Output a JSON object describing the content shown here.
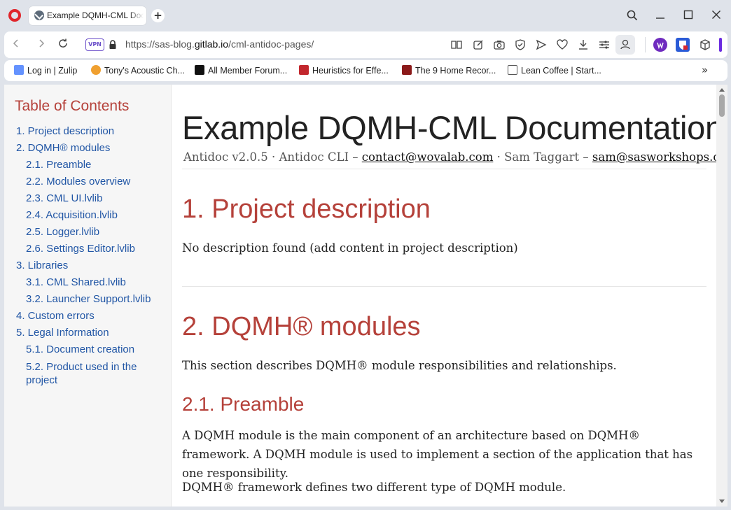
{
  "browser": {
    "tab_title": "Example DQMH-CML Documentation",
    "new_tab_label": "+",
    "url_prefix": "https://sas-blog.",
    "url_host": "gitlab.io",
    "url_path": "/cml-antidoc-pages/",
    "vpn_label": "VPN",
    "bookmarks": [
      "Log in | Zulip",
      "Tony's Acoustic Ch...",
      "All Member Forum...",
      "Heuristics for Effe...",
      "The 9 Home Recor...",
      "Lean Coffee | Start..."
    ],
    "bookmarks_more": "»"
  },
  "toc": {
    "title": "Table of Contents",
    "items": [
      "1. Project description",
      "2. DQMH® modules",
      "2.1. Preamble",
      "2.2. Modules overview",
      "2.3. CML UI.lvlib",
      "2.4. Acquisition.lvlib",
      "2.5. Logger.lvlib",
      "2.6. Settings Editor.lvlib",
      "3. Libraries",
      "3.1. CML Shared.lvlib",
      "3.2. Launcher Support.lvlib",
      "4. Custom errors",
      "5. Legal Information",
      "5.1. Document creation",
      "5.2. Product used in the project"
    ]
  },
  "document": {
    "title": "Example DQMH-CML Documentation",
    "details": {
      "version": "Antidoc v2.0.5 · Antidoc CLI – ",
      "email1": "contact@wovalab.com",
      "author": " · Sam Taggart – ",
      "email2": "sam@sasworkshops.com"
    },
    "section1_heading": "1. Project description",
    "section1_text": "No description found (add content in project description)",
    "section2_heading": "2. DQMH® modules",
    "section2_text": "This section describes DQMH® module responsibilities and relationships.",
    "section21_heading": "2.1. Preamble",
    "section21_para1": "A DQMH module is the main component of an architecture based on DQMH® framework. A DQMH module is used to implement a section of the application that has one responsibility.",
    "section21_para2": "DQMH® framework defines two different type of DQMH module."
  },
  "colors": {
    "heading": "#b5413a",
    "link": "#2156a5",
    "accent_vpn": "#6b4fc9",
    "opera_red": "#e0262b"
  }
}
